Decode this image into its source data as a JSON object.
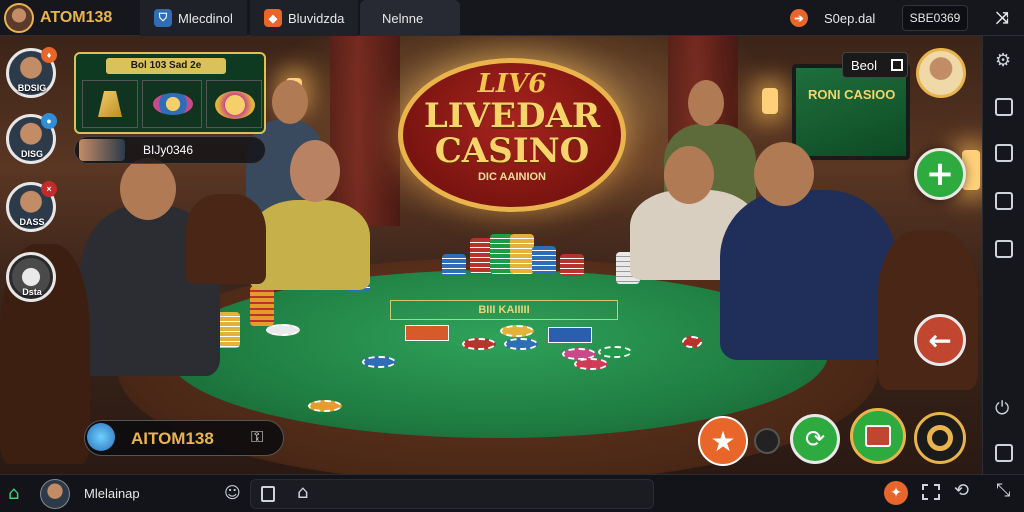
{
  "topbar": {
    "brand": "ATOM138",
    "tab1_label": "Mlecdinol",
    "tab2_label": "Bluvidzda",
    "tab3_label": "Nelnne",
    "right_label": "S0ep.dal",
    "right_value": "SBE0369"
  },
  "logo": {
    "line1": "LIV6",
    "line2": "LIVEDAR",
    "line3": "CASINO",
    "line4": "DIC AAINION"
  },
  "tv_text": "RONI CASIOO",
  "top_right_badge": "Beol",
  "felt_label": "BIII KAIIIII",
  "chips_panel": {
    "title": "Bol 103 Sad 2e"
  },
  "player_card": {
    "label": "BIJy0346"
  },
  "players": [
    {
      "name": "BDSIG"
    },
    {
      "name": "DISG"
    },
    {
      "name": "DASS"
    },
    {
      "name": "Dsta"
    }
  ],
  "bottom_overlay": {
    "brand": "AITOM138"
  },
  "bottombar": {
    "username": "Mlelainap"
  },
  "colors": {
    "accent_orange": "#e8662a",
    "green_btn": "#2eab3f",
    "felt": "#1f7d42",
    "gold": "#e9b44c"
  }
}
